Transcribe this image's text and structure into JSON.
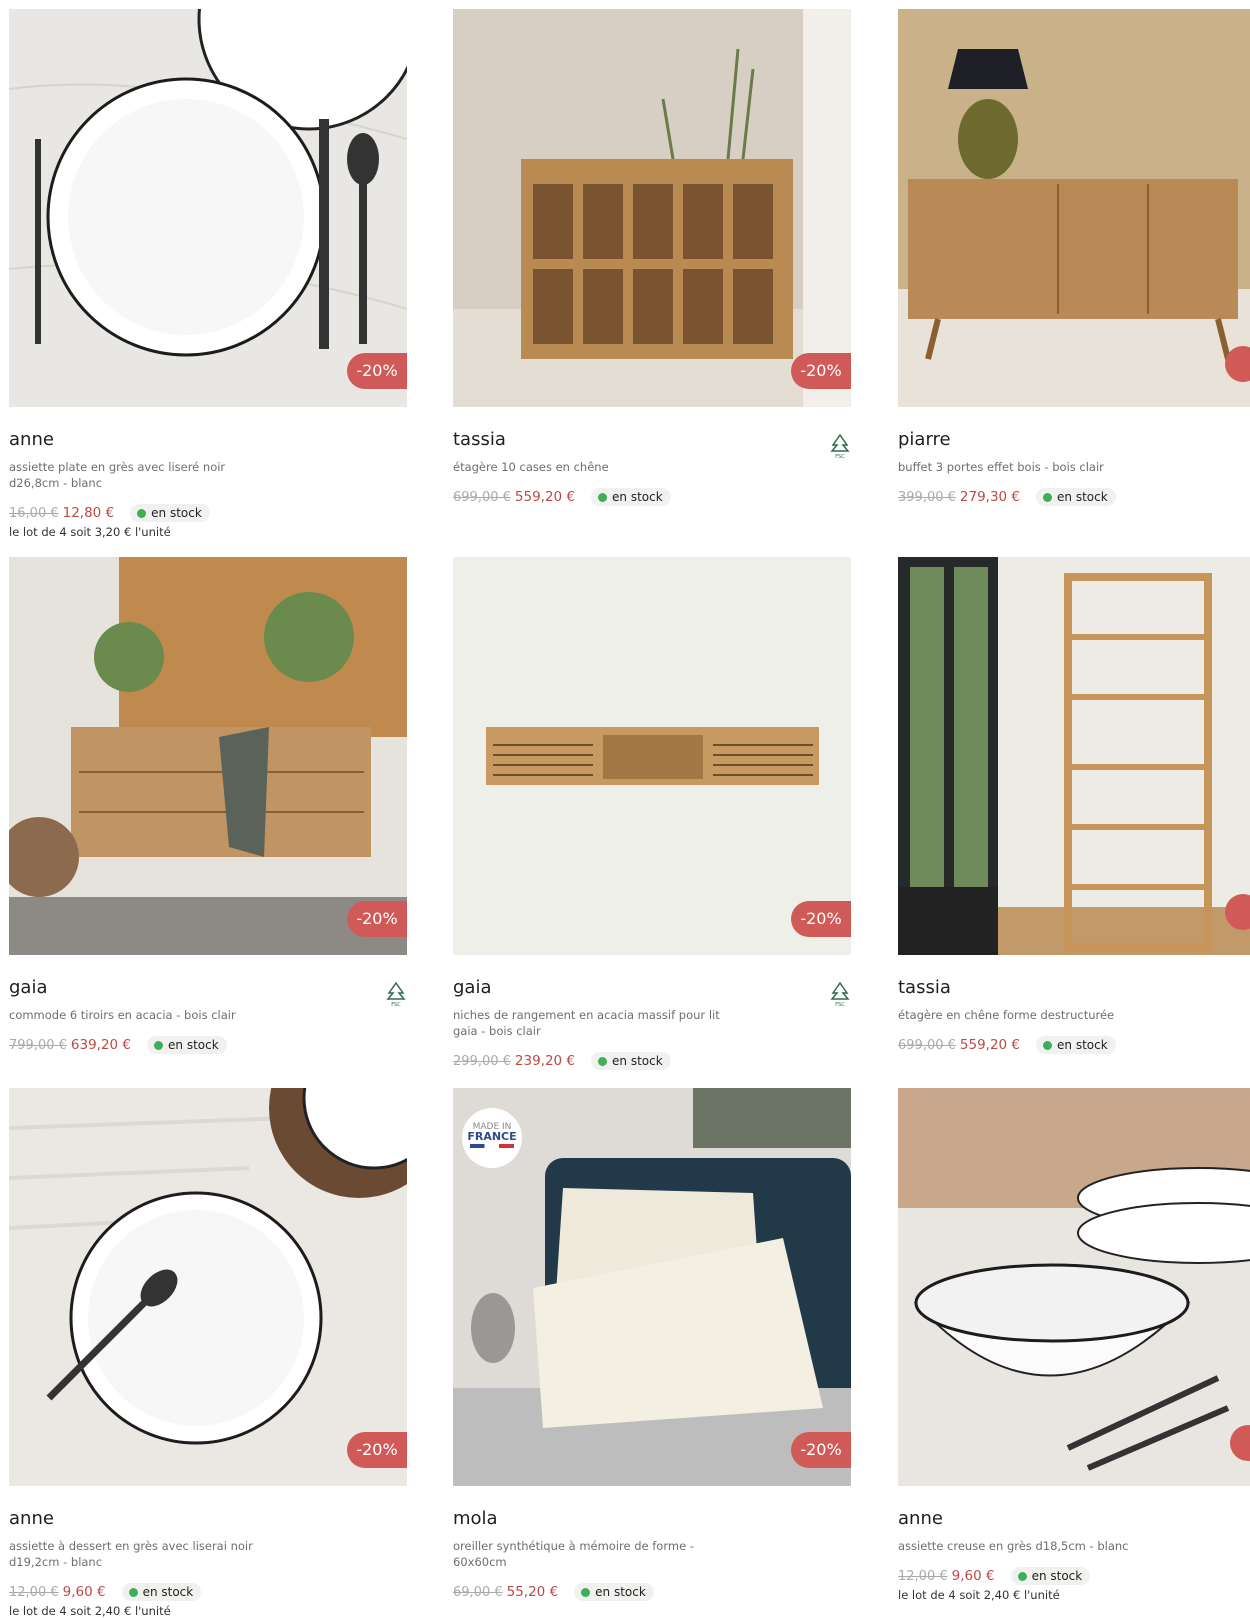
{
  "products": [
    {
      "name": "anne",
      "desc": "assiette plate en grès avec liseré noir d26,8cm - blanc",
      "old_price": "16,00 €",
      "new_price": "12,80 €",
      "stock": "en stock",
      "discount": "-20%",
      "unit": "le lot de 4 soit 3,20 € l'unité"
    },
    {
      "name": "tassia",
      "desc": "étagère 10 cases en chêne",
      "old_price": "699,00 €",
      "new_price": "559,20 €",
      "stock": "en stock",
      "discount": "-20%"
    },
    {
      "name": "piarre",
      "desc": "buffet 3 portes effet bois - bois clair",
      "old_price": "399,00 €",
      "new_price": "279,30 €",
      "stock": "en stock"
    },
    {
      "name": "gaia",
      "desc": "commode 6 tiroirs en acacia - bois clair",
      "old_price": "799,00 €",
      "new_price": "639,20 €",
      "stock": "en stock",
      "discount": "-20%"
    },
    {
      "name": "gaia",
      "desc": "niches de rangement en acacia massif pour lit gaia - bois clair",
      "old_price": "299,00 €",
      "new_price": "239,20 €",
      "stock": "en stock",
      "discount": "-20%"
    },
    {
      "name": "tassia",
      "desc": "étagère en chêne forme destructurée",
      "old_price": "699,00 €",
      "new_price": "559,20 €",
      "stock": "en stock"
    },
    {
      "name": "anne",
      "desc": "assiette à dessert en grès avec liserai noir d19,2cm - blanc",
      "old_price": "12,00 €",
      "new_price": "9,60 €",
      "stock": "en stock",
      "discount": "-20%",
      "unit": "le lot de 4 soit 2,40 € l'unité"
    },
    {
      "name": "mola",
      "desc": "oreiller synthétique à mémoire de forme - 60x60cm",
      "old_price": "69,00 €",
      "new_price": "55,20 €",
      "stock": "en stock",
      "discount": "-20%",
      "badge_top": "MADE IN",
      "badge_bottom": "FRANCE"
    },
    {
      "name": "anne",
      "desc": "assiette creuse en grès d18,5cm - blanc",
      "old_price": "12,00 €",
      "new_price": "9,60 €",
      "stock": "en stock",
      "unit": "le lot de 4 soit 2,40 € l'unité"
    }
  ],
  "icons": {
    "fsc": "fsc-tree-icon",
    "stock": "green-dot-icon"
  },
  "colors": {
    "discount_badge": "#cf5a57",
    "sale_price": "#b94b45",
    "stock_dot": "#3fae5a"
  }
}
